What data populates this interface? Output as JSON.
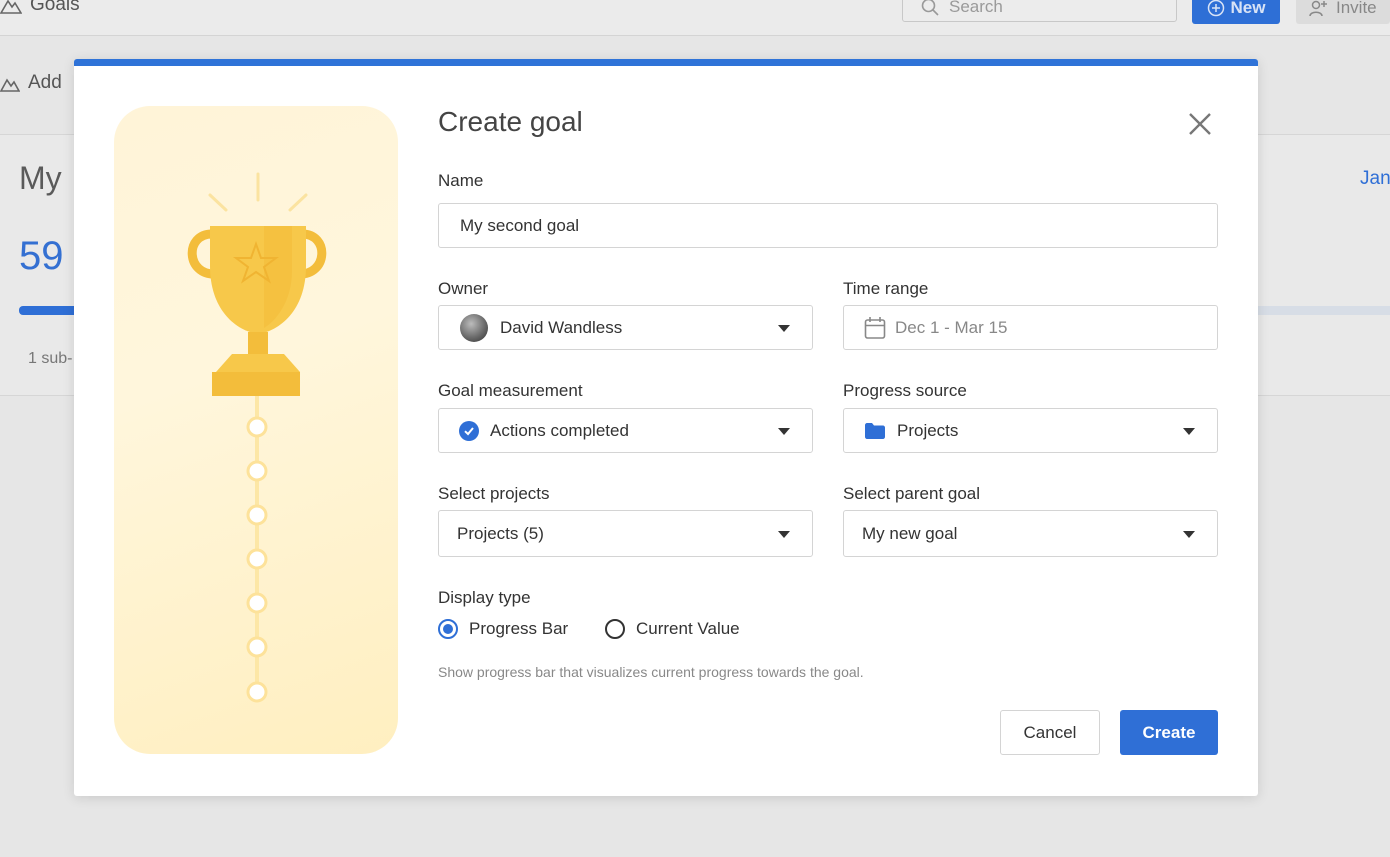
{
  "background": {
    "app_title": "Goals",
    "search_placeholder": "Search",
    "new_label": "New",
    "invite_label": "Invite",
    "add_label": "Add",
    "goal_title": "My",
    "goal_percent": "59",
    "sub_text": "1 sub-",
    "date_partial": "Jan"
  },
  "modal": {
    "title": "Create goal",
    "close_icon": "close-icon",
    "name": {
      "label": "Name",
      "value": "My second goal"
    },
    "owner": {
      "label": "Owner",
      "value": "David Wandless"
    },
    "time_range": {
      "label": "Time range",
      "value": "Dec 1 - Mar 15"
    },
    "goal_measurement": {
      "label": "Goal measurement",
      "value": "Actions completed"
    },
    "progress_source": {
      "label": "Progress source",
      "value": "Projects"
    },
    "select_projects": {
      "label": "Select projects",
      "value": "Projects (5)"
    },
    "parent_goal": {
      "label": "Select parent goal",
      "value": "My new goal"
    },
    "display_type": {
      "label": "Display type",
      "options": [
        {
          "label": "Progress Bar",
          "selected": true
        },
        {
          "label": "Current Value",
          "selected": false
        }
      ],
      "helper": "Show progress bar that visualizes current progress towards the goal."
    },
    "buttons": {
      "cancel": "Cancel",
      "create": "Create"
    }
  },
  "colors": {
    "accent": "#2f6fd6",
    "trophy": "#f7c84a",
    "illustration_bg": "#fff4d8"
  }
}
